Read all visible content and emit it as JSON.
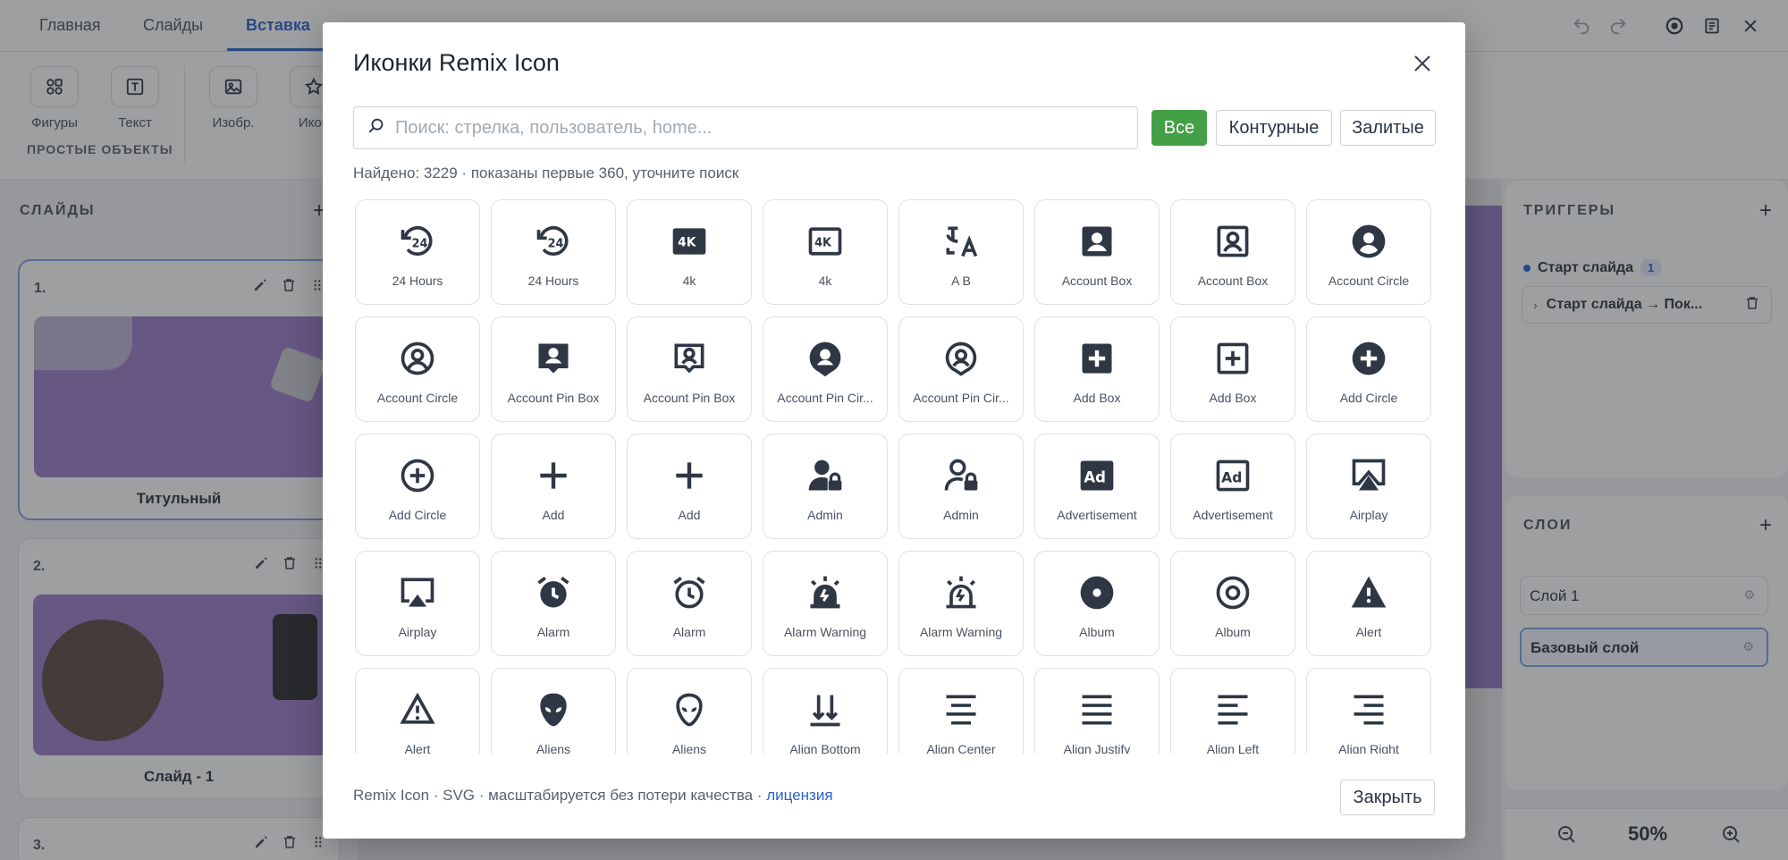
{
  "topbar": {
    "tabs": [
      {
        "label": "Главная"
      },
      {
        "label": "Слайды"
      },
      {
        "label": "Вставка"
      }
    ]
  },
  "ribbon": {
    "buttons": [
      {
        "label": "Фигуры",
        "icon": "shapes-icon"
      },
      {
        "label": "Текст",
        "icon": "text-icon"
      },
      {
        "label": "Изобр.",
        "icon": "image-icon"
      },
      {
        "label": "Икон",
        "icon": "star-icon"
      }
    ],
    "group_label": "ПРОСТЫЕ ОБЪЕКТЫ"
  },
  "slides_panel": {
    "title": "СЛАЙДЫ",
    "slides": [
      {
        "num": "1.",
        "name": "Титульный"
      },
      {
        "num": "2.",
        "name": "Слайд - 1"
      },
      {
        "num": "3.",
        "name": ""
      }
    ]
  },
  "triggers_panel": {
    "title": "ТРИГГЕРЫ",
    "group": "Старт слайда",
    "count": "1",
    "item": "Старт слайда → Пок..."
  },
  "layers_panel": {
    "title": "СЛОИ",
    "layers": [
      {
        "label": "Слой 1"
      },
      {
        "label": "Базовый слой"
      }
    ]
  },
  "zoom": {
    "value": "50%"
  },
  "modal": {
    "title": "Иконки Remix Icon",
    "search_placeholder": "Поиск: стрелка, пользователь, home...",
    "filters": [
      {
        "label": "Все",
        "active": true
      },
      {
        "label": "Контурные",
        "active": false
      },
      {
        "label": "Залитые",
        "active": false
      }
    ],
    "found_text": "Найдено: 3229 · показаны первые 360, уточните поиск",
    "icons": [
      {
        "label": "24 Hours",
        "icon": "24-hours-icon"
      },
      {
        "label": "24 Hours",
        "icon": "24-hours-icon"
      },
      {
        "label": "4k",
        "icon": "4k-fill-icon"
      },
      {
        "label": "4k",
        "icon": "4k-line-icon"
      },
      {
        "label": "A B",
        "icon": "translate-icon"
      },
      {
        "label": "Account Box",
        "icon": "account-box-fill-icon"
      },
      {
        "label": "Account Box",
        "icon": "account-box-line-icon"
      },
      {
        "label": "Account Circle",
        "icon": "account-circle-fill-icon"
      },
      {
        "label": "Account Circle",
        "icon": "account-circle-line-icon"
      },
      {
        "label": "Account Pin Box",
        "icon": "account-pin-box-fill-icon"
      },
      {
        "label": "Account Pin Box",
        "icon": "account-pin-box-line-icon"
      },
      {
        "label": "Account Pin Cir...",
        "icon": "account-pin-circle-fill-icon"
      },
      {
        "label": "Account Pin Cir...",
        "icon": "account-pin-circle-line-icon"
      },
      {
        "label": "Add Box",
        "icon": "add-box-fill-icon"
      },
      {
        "label": "Add Box",
        "icon": "add-box-line-icon"
      },
      {
        "label": "Add Circle",
        "icon": "add-circle-fill-icon"
      },
      {
        "label": "Add Circle",
        "icon": "add-circle-line-icon"
      },
      {
        "label": "Add",
        "icon": "add-icon"
      },
      {
        "label": "Add",
        "icon": "add-icon"
      },
      {
        "label": "Admin",
        "icon": "admin-fill-icon"
      },
      {
        "label": "Admin",
        "icon": "admin-line-icon"
      },
      {
        "label": "Advertisement",
        "icon": "advertisement-fill-icon"
      },
      {
        "label": "Advertisement",
        "icon": "advertisement-line-icon"
      },
      {
        "label": "Airplay",
        "icon": "airplay-fill-icon"
      },
      {
        "label": "Airplay",
        "icon": "airplay-line-icon"
      },
      {
        "label": "Alarm",
        "icon": "alarm-fill-icon"
      },
      {
        "label": "Alarm",
        "icon": "alarm-line-icon"
      },
      {
        "label": "Alarm Warning",
        "icon": "alarm-warning-fill-icon"
      },
      {
        "label": "Alarm Warning",
        "icon": "alarm-warning-line-icon"
      },
      {
        "label": "Album",
        "icon": "album-fill-icon"
      },
      {
        "label": "Album",
        "icon": "album-line-icon"
      },
      {
        "label": "Alert",
        "icon": "alert-fill-icon"
      },
      {
        "label": "Alert",
        "icon": "alert-line-icon"
      },
      {
        "label": "Aliens",
        "icon": "aliens-fill-icon"
      },
      {
        "label": "Aliens",
        "icon": "aliens-line-icon"
      },
      {
        "label": "Align Bottom",
        "icon": "align-bottom-icon"
      },
      {
        "label": "Align Center",
        "icon": "align-center-icon"
      },
      {
        "label": "Align Justify",
        "icon": "align-justify-icon"
      },
      {
        "label": "Align Left",
        "icon": "align-left-icon"
      },
      {
        "label": "Align Right",
        "icon": "align-right-icon"
      }
    ],
    "footer_text": "Remix Icon · SVG · масштабируется без потери качества · ",
    "footer_link": "лицензия",
    "close_label": "Закрыть"
  }
}
